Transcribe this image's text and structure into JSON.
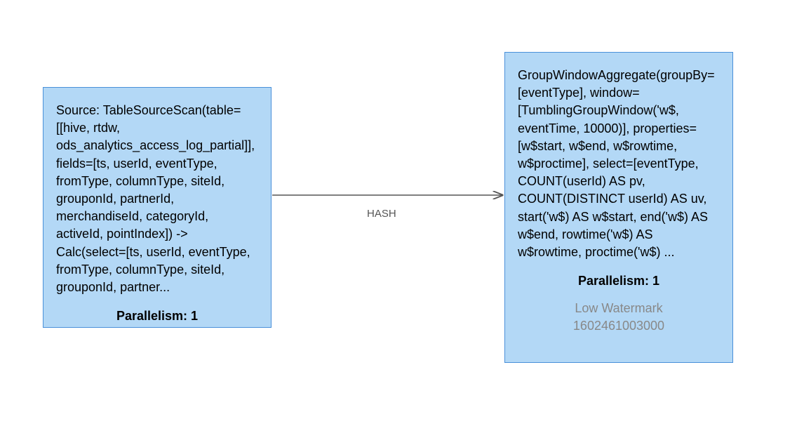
{
  "nodes": {
    "source": {
      "text": "Source: TableSourceScan(table=[[hive, rtdw, ods_analytics_access_log_partial]], fields=[ts, userId, eventType, fromType, columnType, siteId, grouponId, partnerId, merchandiseId, categoryId, activeId, pointIndex]) -> Calc(select=[ts, userId, eventType, fromType, columnType, siteId, grouponId, partner...",
      "parallelism_label": "Parallelism: 1"
    },
    "aggregate": {
      "text": "GroupWindowAggregate(groupBy=[eventType], window=[TumblingGroupWindow('w$, eventTime, 10000)], properties=[w$start, w$end, w$rowtime, w$proctime], select=[eventType, COUNT(userId) AS pv, COUNT(DISTINCT userId) AS uv, start('w$) AS w$start, end('w$) AS w$end, rowtime('w$) AS w$rowtime, proctime('w$) ...",
      "parallelism_label": "Parallelism: 1",
      "watermark_label": "Low Watermark",
      "watermark_value": "1602461003000"
    }
  },
  "edge": {
    "label": "HASH"
  }
}
